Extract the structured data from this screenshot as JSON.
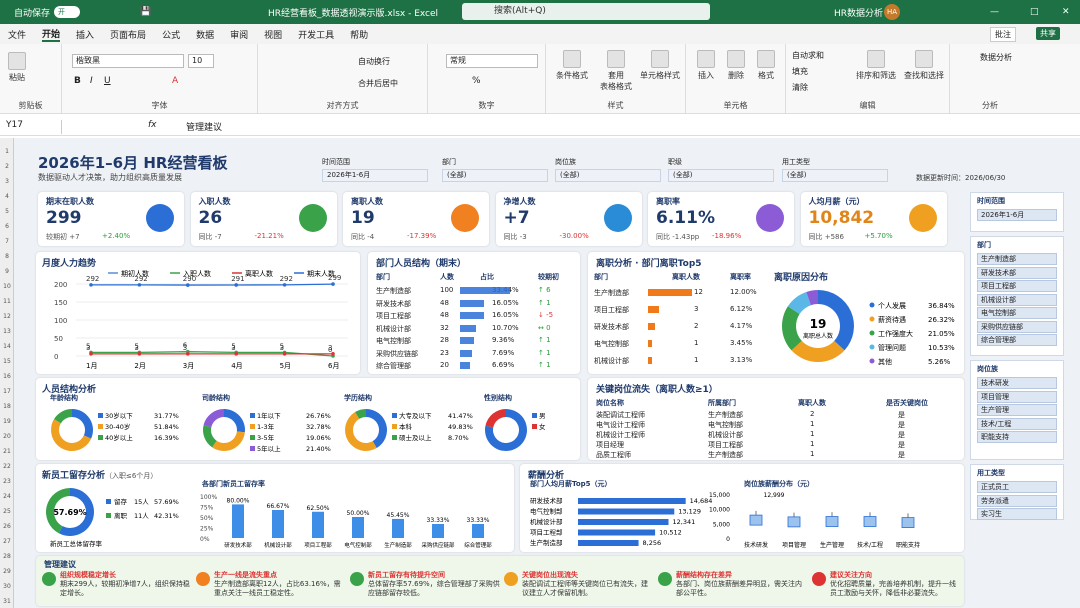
{
  "app": {
    "autosave": "自动保存",
    "toggle": "开",
    "filename": "HR经营看板_数据透视演示版.xlsx - Excel",
    "search": "搜索(Alt+Q)",
    "user": "HR数据分析",
    "initials": "HA",
    "comment": "批注",
    "share": "共享"
  },
  "menu": [
    "文件",
    "开始",
    "插入",
    "页面布局",
    "公式",
    "数据",
    "审阅",
    "视图",
    "开发工具",
    "帮助"
  ],
  "ribbon": {
    "paste": "粘贴",
    "clipboard": "剪贴板",
    "font_name": "楷致黑",
    "font_size": "10",
    "font": "字体",
    "wrap": "自动换行",
    "merge": "合并后居中",
    "align": "对齐方式",
    "numfmt": "常规",
    "number": "数字",
    "cond": "条件格式",
    "table": "套用\n表格格式",
    "cellstyle": "单元格样式",
    "style": "样式",
    "insert": "插入",
    "delete": "删除",
    "format": "格式",
    "cells": "单元格",
    "autosum": "自动求和",
    "fill": "填充",
    "clear": "清除",
    "sort": "排序和筛选",
    "find": "查找和选择",
    "edit": "编辑",
    "analysis": "数据分析",
    "analysis_group": "分析"
  },
  "formula": {
    "cell": "Y17",
    "content": "管理建议"
  },
  "dash": {
    "title": "2026年1–6月  HR经营看板",
    "subtitle": "数据驱动人才决策，助力组织高质量发展",
    "update": "数据更新时间：2026/06/30",
    "filters": [
      {
        "label": "时间范围",
        "value": "2026年1-6月"
      },
      {
        "label": "部门",
        "value": "(全部)"
      },
      {
        "label": "岗位族",
        "value": "(全部)"
      },
      {
        "label": "职级",
        "value": "(全部)"
      },
      {
        "label": "用工类型",
        "value": "(全部)"
      }
    ]
  },
  "kpis": [
    {
      "title": "期末在职人数",
      "value": "299",
      "s1": "较期初",
      "d1": "+7",
      "d2": "+2.40%",
      "c": "#2a6ed6"
    },
    {
      "title": "入职人数",
      "value": "26",
      "s1": "同比",
      "d1": "-7",
      "d2": "-21.21%",
      "c": "#3aa34a"
    },
    {
      "title": "离职人数",
      "value": "19",
      "s1": "同比",
      "d1": "-4",
      "d2": "-17.39%",
      "c": "#f08020"
    },
    {
      "title": "净增人数",
      "value": "+7",
      "s1": "同比",
      "d1": "-3",
      "d2": "-30.00%",
      "c": "#2a8bd6"
    },
    {
      "title": "离职率",
      "value": "6.11%",
      "s1": "同比",
      "d1": "-1.43pp",
      "d2": "-18.96%",
      "c": "#8b5cd6"
    },
    {
      "title": "人均月薪（元）",
      "value": "10,842",
      "s1": "同比",
      "d1": "+586",
      "d2": "+5.70%",
      "c": "#f0a020"
    }
  ],
  "trend": {
    "title": "月度人力趋势",
    "legend": [
      "期初人数",
      "入职人数",
      "离职人数",
      "期末人数"
    ],
    "months": [
      "1月",
      "2月",
      "3月",
      "4月",
      "5月",
      "6月"
    ],
    "end": [
      292,
      292,
      290,
      291,
      292,
      299
    ],
    "inn": [
      5,
      5,
      6,
      5,
      5,
      0
    ],
    "out": [
      3,
      3,
      3,
      3,
      3,
      3
    ],
    "yticks": [
      "200",
      "150",
      "100",
      "50",
      "0"
    ]
  },
  "dept": {
    "title": "部门人员结构（期末）",
    "cols": [
      "部门",
      "人数",
      "占比",
      "较期初"
    ],
    "rows": [
      [
        "生产制造部",
        "100",
        "33.44%",
        "↑ 6"
      ],
      [
        "研发技术部",
        "48",
        "16.05%",
        "↑ 1"
      ],
      [
        "项目工程部",
        "48",
        "16.05%",
        "↓ -5"
      ],
      [
        "机械设计部",
        "32",
        "10.70%",
        "↔ 0"
      ],
      [
        "电气控制部",
        "28",
        "9.36%",
        "↑ 1"
      ],
      [
        "采购供应链部",
        "23",
        "7.69%",
        "↑ 1"
      ],
      [
        "综合管理部",
        "20",
        "6.69%",
        "↑ 1"
      ]
    ]
  },
  "quit": {
    "title": "离职分析 · 部门离职Top5",
    "cols": [
      "部门",
      "离职人数",
      "离职率"
    ],
    "rows": [
      [
        "生产制造部",
        "12",
        "12.00%"
      ],
      [
        "项目工程部",
        "3",
        "6.12%"
      ],
      [
        "研发技术部",
        "2",
        "4.17%"
      ],
      [
        "电气控制部",
        "1",
        "3.45%"
      ],
      [
        "机械设计部",
        "1",
        "3.13%"
      ]
    ],
    "reason_title": "离职原因分布",
    "center": "19",
    "center_label": "离职总人数",
    "reasons": [
      [
        "个人发展",
        "36.84%"
      ],
      [
        "薪资待遇",
        "26.32%"
      ],
      [
        "工作强度大",
        "21.05%"
      ],
      [
        "管理问题",
        "10.53%"
      ],
      [
        "其他",
        "5.26%"
      ]
    ]
  },
  "struct": {
    "title": "人员结构分析",
    "age": {
      "t": "年龄结构",
      "rows": [
        [
          "30岁以下",
          "31.77%"
        ],
        [
          "30-40岁",
          "51.84%"
        ],
        [
          "40岁以上",
          "16.39%"
        ]
      ]
    },
    "tenure": {
      "t": "司龄结构",
      "rows": [
        [
          "1年以下",
          "26.76%"
        ],
        [
          "1-3年",
          "32.78%"
        ],
        [
          "3-5年",
          "19.06%"
        ],
        [
          "5年以上",
          "21.40%"
        ]
      ]
    },
    "edu": {
      "t": "学历结构",
      "rows": [
        [
          "大专及以下",
          "41.47%"
        ],
        [
          "本科",
          "49.83%"
        ],
        [
          "硕士及以上",
          "8.70%"
        ]
      ]
    },
    "gender": {
      "t": "性别结构",
      "rows": [
        [
          "男",
          "78.26%"
        ],
        [
          "女",
          "21.74%"
        ]
      ]
    }
  },
  "key": {
    "title": "关键岗位流失（离职人数≥1）",
    "cols": [
      "岗位名称",
      "所属部门",
      "离职人数",
      "是否关键岗位"
    ],
    "rows": [
      [
        "装配调试工程师",
        "生产制造部",
        "2",
        "是"
      ],
      [
        "电气设计工程师",
        "电气控制部",
        "1",
        "是"
      ],
      [
        "机械设计工程师",
        "机械设计部",
        "1",
        "是"
      ],
      [
        "项目经理",
        "项目工程部",
        "1",
        "是"
      ],
      [
        "品质工程师",
        "生产制造部",
        "1",
        "是"
      ]
    ]
  },
  "retain": {
    "title": "新员工留存分析",
    "sub": "（入职≤6个月）",
    "center": "57.69%",
    "l1": "留存",
    "v1": "15人",
    "p1": "57.69%",
    "l2": "离职",
    "v2": "11人",
    "p2": "42.31%",
    "foot": "新员工总体留存率",
    "bar_title": "各部门新员工留存率",
    "cats": [
      "研发技术部",
      "机械设计部",
      "项目工程部",
      "电气控制部",
      "生产制造部",
      "采购供应链部",
      "综合管理部"
    ],
    "vals": [
      80.0,
      66.67,
      62.5,
      50.0,
      45.45,
      33.33,
      33.33
    ],
    "labels": [
      "80.00%",
      "66.67%",
      "62.50%",
      "50.00%",
      "45.45%",
      "33.33%",
      "33.33%"
    ],
    "yt": [
      "100%",
      "75%",
      "50%",
      "25%",
      "0%"
    ]
  },
  "salary": {
    "title": "薪酬分析",
    "top_title": "部门人均月薪Top5（元）",
    "top": [
      [
        "研发技术部",
        "14,684"
      ],
      [
        "电气控制部",
        "13,129"
      ],
      [
        "机械设计部",
        "12,341"
      ],
      [
        "项目工程部",
        "10,512"
      ],
      [
        "生产制造部",
        "8,256"
      ]
    ],
    "top_vals": [
      14684,
      13129,
      12341,
      10512,
      8256
    ],
    "box_title": "岗位族薪酬分布（元）",
    "box_cats": [
      "技术研发",
      "项目管理",
      "生产管理",
      "技术/工程",
      "职能支持"
    ],
    "box_max": "12,999",
    "yt": [
      "15,000",
      "10,000",
      "5,000",
      "0"
    ]
  },
  "slicers": [
    {
      "title": "时间范围",
      "items": [
        "2026年1-6月"
      ]
    },
    {
      "title": "部门",
      "items": [
        "生产制造部",
        "研发技术部",
        "项目工程部",
        "机械设计部",
        "电气控制部",
        "采购供应链部",
        "综合管理部"
      ]
    },
    {
      "title": "岗位族",
      "items": [
        "技术研发",
        "项目管理",
        "生产管理",
        "技术/工程",
        "职能支持"
      ]
    },
    {
      "title": "用工类型",
      "items": [
        "正式员工",
        "劳务派遣",
        "实习生"
      ]
    }
  ],
  "advice": {
    "title": "管理建议",
    "items": [
      {
        "h": "组织规模稳定增长",
        "t": "期末299人，较期初净增7人，组织保持稳定增长。",
        "c": "#3aa34a"
      },
      {
        "h": "生产一线是流失重点",
        "t": "生产制造部离职12人，占比63.16%，需重点关注一线员工稳定性。",
        "c": "#f08020"
      },
      {
        "h": "新员工留存有待提升空间",
        "t": "总体留存率57.69%，综合管理部了采购供应链部留存较低。",
        "c": "#3aa34a"
      },
      {
        "h": "关键岗位出现流失",
        "t": "装配调试工程师等关键岗位已有流失，建议建立人才保留机制。",
        "c": "#f0a020"
      },
      {
        "h": "薪酬结构存在差异",
        "t": "各部门、岗位族薪酬差异明显，需关注内部公平性。",
        "c": "#3aa34a"
      },
      {
        "h": "建议关注方向",
        "t": "优化招聘质量，完善培养机制，提升一线员工激励与关怀，降低非必要流失。",
        "c": "#d33"
      }
    ]
  }
}
